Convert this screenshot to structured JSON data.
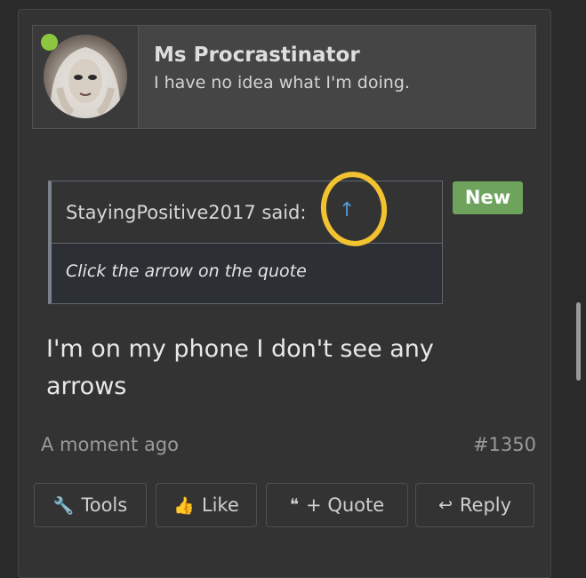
{
  "user": {
    "name": "Ms Procrastinator",
    "title": "I have no idea what I'm doing.",
    "status_color": "#8dc63f"
  },
  "quote": {
    "author": "StayingPositive2017 said:",
    "arrow": "↑",
    "text": "Click the arrow on the quote"
  },
  "badge": {
    "label": "New",
    "color": "#6ea35d"
  },
  "post": {
    "message": "I'm on my phone I don't see any arrows",
    "timestamp": "A moment ago",
    "number": "#1350"
  },
  "actions": [
    {
      "label": "Tools",
      "icon": "wrench-icon",
      "glyph": "🔧"
    },
    {
      "label": "Like",
      "icon": "thumbs-up-icon",
      "glyph": "👍"
    },
    {
      "label": "+ Quote",
      "icon": "quote-icon",
      "glyph": "❝"
    },
    {
      "label": "Reply",
      "icon": "reply-icon",
      "glyph": "↩"
    }
  ],
  "annotation_color": "#f2c230"
}
